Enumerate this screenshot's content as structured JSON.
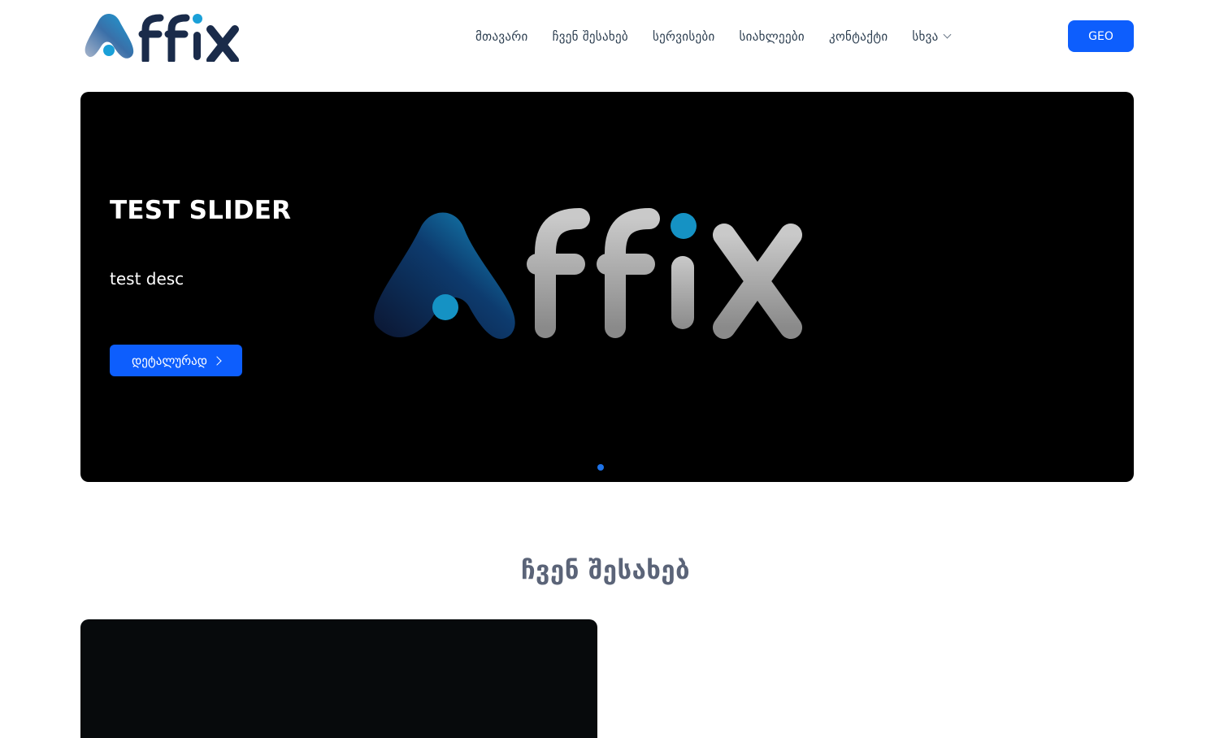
{
  "header": {
    "logo_text": "AffiX",
    "nav": [
      {
        "label": "მთავარი"
      },
      {
        "label": "ჩვენ შესახებ"
      },
      {
        "label": "სერვისები"
      },
      {
        "label": "სიახლეები"
      },
      {
        "label": "კონტაქტი"
      },
      {
        "label": "სხვა",
        "has_dropdown": true
      }
    ],
    "language_button": "GEO"
  },
  "hero": {
    "title": "TEST SLIDER",
    "description": "test desc",
    "button_label": "დეტალურად",
    "image_text": "AffiX",
    "active_slide": 1,
    "slide_count": 1
  },
  "about": {
    "title": "ჩვენ შესახებ"
  },
  "colors": {
    "accent": "#0d5efd",
    "hero_bg": "#000000",
    "logo_dark": "#1a2b4a",
    "logo_blue": "#1aa0d8"
  },
  "icons": {
    "dropdown": "chevron-down-icon",
    "button_arrow": "chevron-right-icon"
  }
}
